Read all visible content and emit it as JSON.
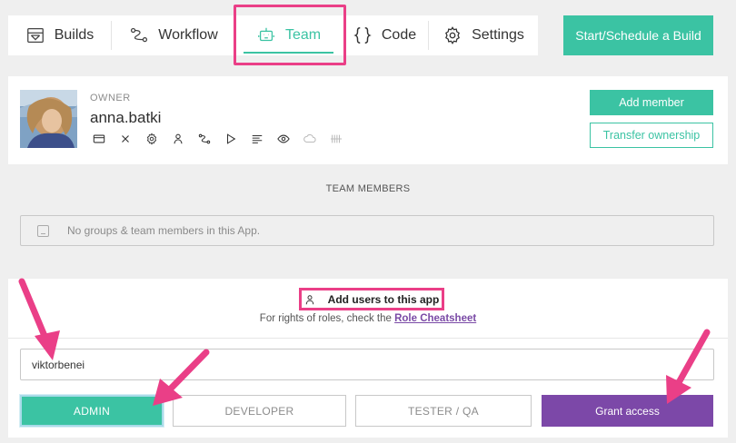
{
  "nav": {
    "tabs": [
      {
        "label": "Builds",
        "icon": "builds-icon"
      },
      {
        "label": "Workflow",
        "icon": "workflow-icon"
      },
      {
        "label": "Team",
        "icon": "robot-icon",
        "active": true
      },
      {
        "label": "Code",
        "icon": "braces-icon"
      },
      {
        "label": "Settings",
        "icon": "gear-icon"
      }
    ],
    "start_button": "Start/Schedule a Build"
  },
  "owner": {
    "role": "OWNER",
    "name": "anna.batki",
    "permission_icons": [
      "card-icon",
      "close-icon",
      "gear-icon",
      "person-icon",
      "workflow-icon",
      "play-icon",
      "lines-icon",
      "eye-icon",
      "cloud-icon",
      "barcode-icon"
    ],
    "add_member_button": "Add member",
    "transfer_button": "Transfer ownership"
  },
  "team_members": {
    "title": "TEAM MEMBERS",
    "empty_text": "No groups & team members in this App."
  },
  "add_users": {
    "title": "Add users to this app",
    "rights_text": "For rights of roles, check the",
    "rights_link": "Role Cheatsheet",
    "input_value": "viktorbenei",
    "roles": [
      "ADMIN",
      "DEVELOPER",
      "TESTER / QA"
    ],
    "selected_role": "ADMIN",
    "grant_button": "Grant access"
  },
  "colors": {
    "accent": "#3bc3a3",
    "purple": "#7c48a8",
    "highlight": "#ea3f87"
  }
}
